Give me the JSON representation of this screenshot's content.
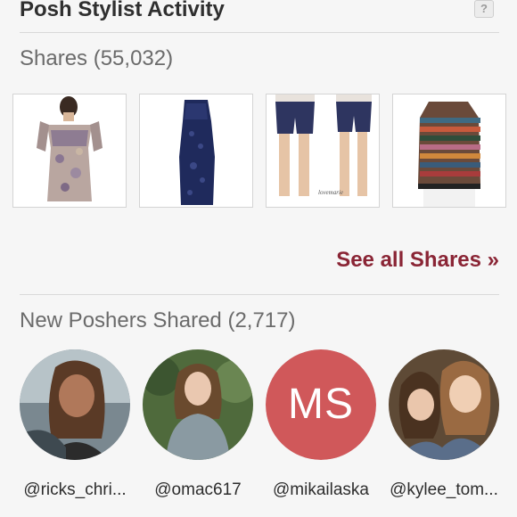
{
  "header": {
    "title": "Posh Stylist Activity",
    "help_label": "?"
  },
  "shares": {
    "title": "Shares (55,032)",
    "see_all": "See all Shares »",
    "watermark": "lovemarie"
  },
  "new_poshers": {
    "title": "New Poshers Shared (2,717)",
    "users": [
      {
        "handle": "@ricks_chri..."
      },
      {
        "handle": "@omac617"
      },
      {
        "handle": "@mikailaska",
        "initials": "MS"
      },
      {
        "handle": "@kylee_tom..."
      }
    ]
  },
  "colors": {
    "accent": "#8a2535",
    "initials_bg": "#d0585a",
    "background": "#f6f6f6"
  }
}
